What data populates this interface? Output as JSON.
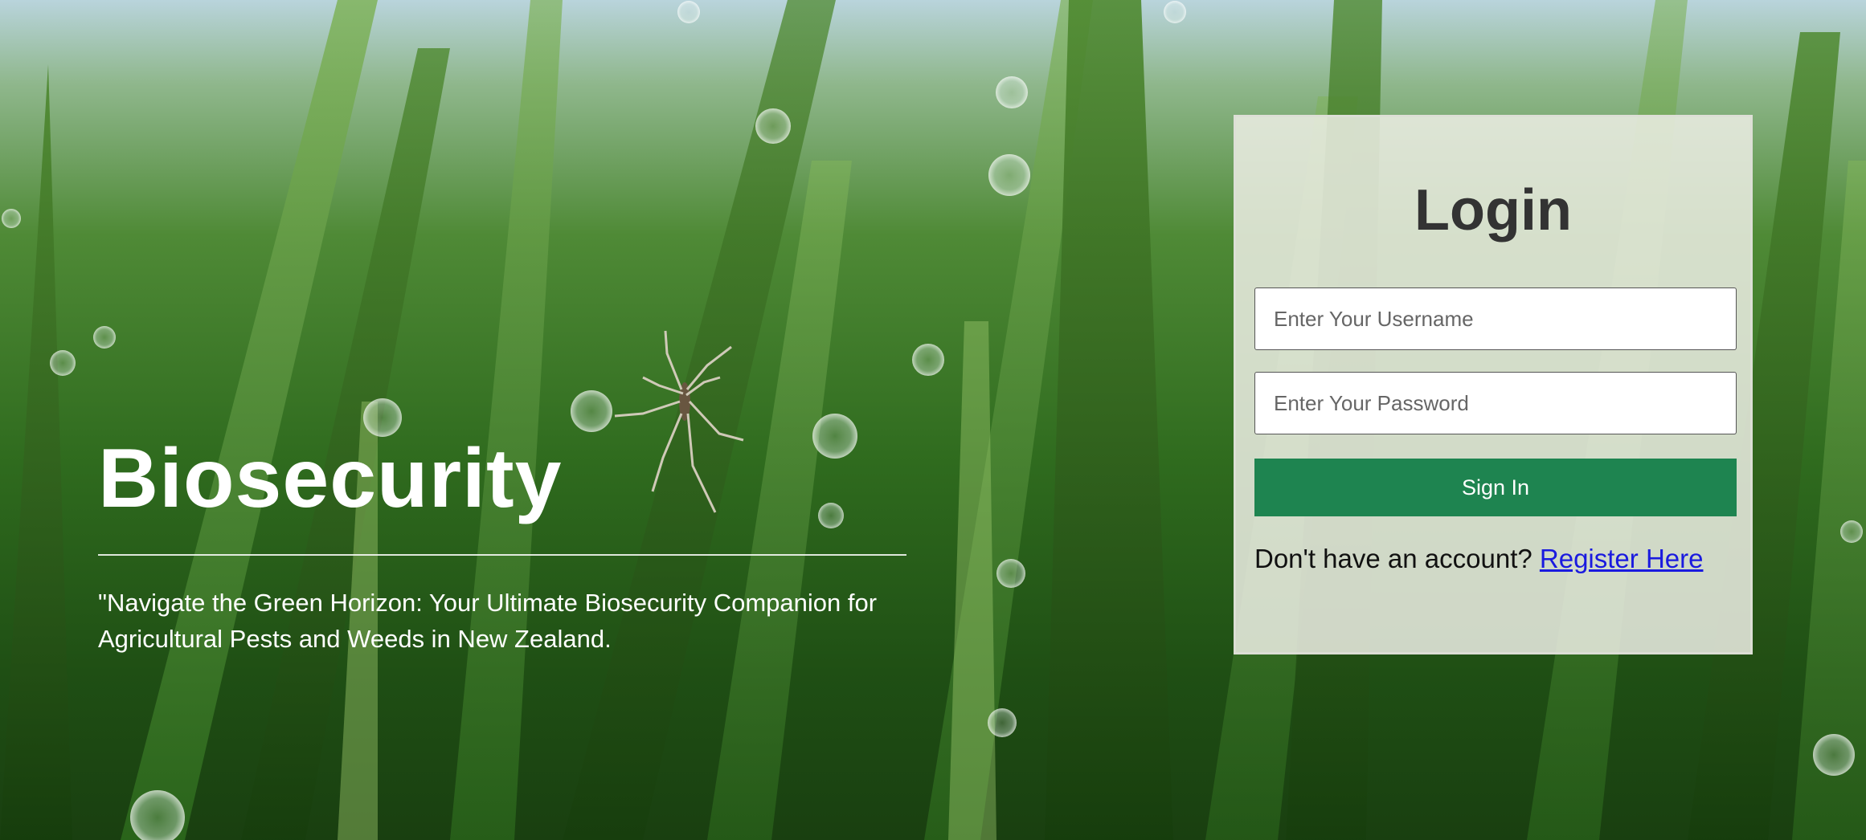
{
  "hero": {
    "title": "Biosecurity",
    "tagline": "\"Navigate the Green Horizon: Your Ultimate Biosecurity Companion for Agricultural Pests and Weeds in New Zealand."
  },
  "login": {
    "title": "Login",
    "username_placeholder": "Enter Your Username",
    "password_placeholder": "Enter Your Password",
    "signin_label": "Sign In",
    "register_prompt": "Don't have an account?",
    "register_link": "Register Here"
  },
  "colors": {
    "signin_button": "#1e8450",
    "register_link": "#1a1adf",
    "title_text": "#333333"
  }
}
